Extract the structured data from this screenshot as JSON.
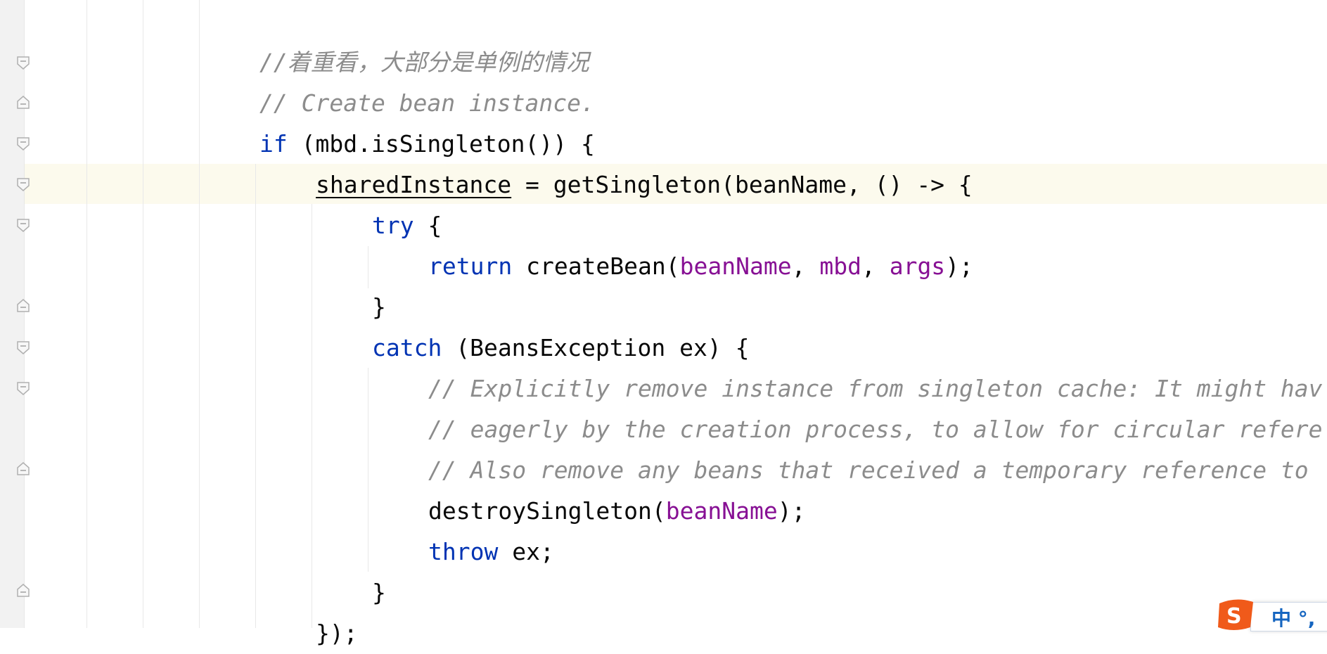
{
  "editor": {
    "lines": [
      {
        "id": "l1",
        "segments": [
          {
            "t": "//着重看，大部分是单例的情况",
            "c": "cm"
          }
        ]
      },
      {
        "id": "l2",
        "segments": [
          {
            "t": "// Create bean instance.",
            "c": "cm"
          }
        ]
      },
      {
        "id": "l3",
        "segments": [
          {
            "t": "if",
            "c": "kw"
          },
          {
            "t": " (mbd.isSingleton()) {",
            "c": ""
          }
        ]
      },
      {
        "id": "l4",
        "segments": [
          {
            "t": "sharedInstance",
            "c": "under"
          },
          {
            "t": " = getSingleton(beanName, () -> {",
            "c": ""
          }
        ]
      },
      {
        "id": "l5",
        "segments": [
          {
            "t": "try",
            "c": "kw"
          },
          {
            "t": " {",
            "c": ""
          }
        ]
      },
      {
        "id": "l6",
        "segments": [
          {
            "t": "return",
            "c": "kw"
          },
          {
            "t": " createBean(",
            "c": ""
          },
          {
            "t": "beanName",
            "c": "par"
          },
          {
            "t": ", ",
            "c": ""
          },
          {
            "t": "mbd",
            "c": "par"
          },
          {
            "t": ", ",
            "c": ""
          },
          {
            "t": "args",
            "c": "par"
          },
          {
            "t": ");",
            "c": ""
          }
        ]
      },
      {
        "id": "l7",
        "segments": [
          {
            "t": "}",
            "c": ""
          }
        ]
      },
      {
        "id": "l8",
        "segments": [
          {
            "t": "catch",
            "c": "kw"
          },
          {
            "t": " (BeansException ex) {",
            "c": ""
          }
        ]
      },
      {
        "id": "l9",
        "segments": [
          {
            "t": "// Explicitly remove instance from singleton cache: It might hav",
            "c": "cm"
          }
        ]
      },
      {
        "id": "l10",
        "segments": [
          {
            "t": "// eagerly by the creation process, to allow for circular refere",
            "c": "cm"
          }
        ]
      },
      {
        "id": "l11",
        "segments": [
          {
            "t": "// Also remove any beans that received a temporary reference to",
            "c": "cm"
          }
        ]
      },
      {
        "id": "l12",
        "segments": [
          {
            "t": "destroySingleton(",
            "c": ""
          },
          {
            "t": "beanName",
            "c": "par"
          },
          {
            "t": ");",
            "c": ""
          }
        ]
      },
      {
        "id": "l13",
        "segments": [
          {
            "t": "throw",
            "c": "kw"
          },
          {
            "t": " ex;",
            "c": ""
          }
        ]
      },
      {
        "id": "l14",
        "segments": [
          {
            "t": "}",
            "c": ""
          }
        ]
      },
      {
        "id": "l15",
        "segments": [
          {
            "t": "});",
            "c": ""
          }
        ]
      }
    ]
  },
  "ime": {
    "icon": "sogou-ime-icon",
    "text": "中 °,"
  },
  "colors": {
    "keyword": "#0033b3",
    "comment": "#8c8c8c",
    "parameter": "#871094",
    "caret_row": "#fcfaed",
    "ime_accent": "#1565c0"
  }
}
